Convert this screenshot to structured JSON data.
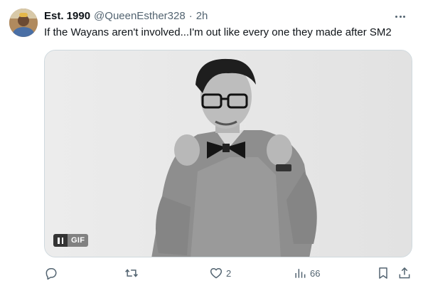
{
  "tweet": {
    "display_name": "Est. 1990",
    "handle": "@QueenEsther328",
    "separator": "·",
    "timestamp": "2h",
    "text": "If the Wayans aren't involved...I'm out like every one they made after SM2",
    "more_icon": "more-horizontal-icon",
    "avatar_icon": "user-avatar"
  },
  "media": {
    "type": "gif",
    "badge_label": "GIF",
    "pause_icon": "pause-icon"
  },
  "actions": {
    "reply": {
      "icon": "reply-icon",
      "count": ""
    },
    "retweet": {
      "icon": "retweet-icon",
      "count": ""
    },
    "like": {
      "icon": "heart-icon",
      "count": "2"
    },
    "views": {
      "icon": "views-chart-icon",
      "count": "66"
    },
    "bookmark": {
      "icon": "bookmark-icon"
    },
    "share": {
      "icon": "share-icon"
    }
  },
  "colors": {
    "text_primary": "#0f1419",
    "text_secondary": "#536471",
    "border": "#cfd9de"
  }
}
